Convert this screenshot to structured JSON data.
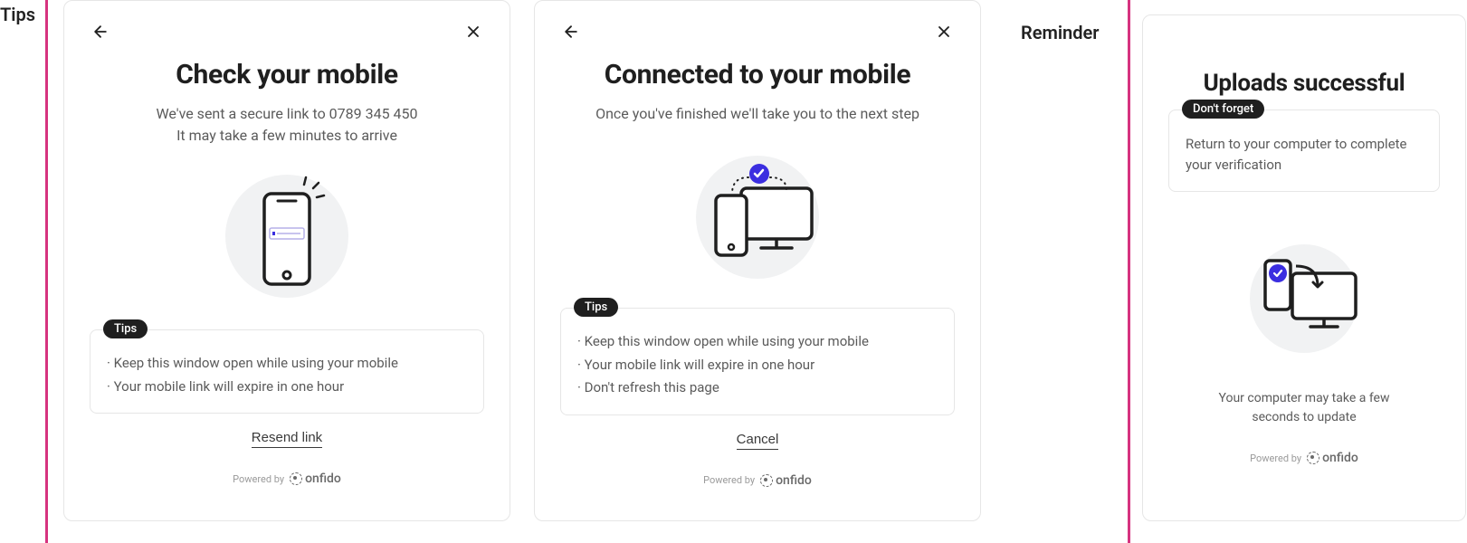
{
  "labels": {
    "tips": "Tips",
    "reminder": "Reminder"
  },
  "card1": {
    "title": "Check your mobile",
    "subtitle_line1": "We've sent a secure link to 0789 345 450",
    "subtitle_line2": "It may take a few minutes to arrive",
    "tips_label": "Tips",
    "tips": [
      "Keep this window open while using your mobile",
      "Your mobile link will expire in one hour"
    ],
    "action": "Resend link",
    "powered": "Powered by",
    "brand": "onfido"
  },
  "card2": {
    "title": "Connected to your mobile",
    "subtitle": "Once you've finished we'll take you to the next step",
    "tips_label": "Tips",
    "tips": [
      "Keep this window open while using your mobile",
      "Your mobile link will expire in one hour",
      "Don't refresh this page"
    ],
    "action": "Cancel",
    "powered": "Powered by",
    "brand": "onfido"
  },
  "card3": {
    "title": "Uploads successful",
    "reminder_label": "Don't forget",
    "reminder_text": "Return to your computer to complete your verification",
    "caption_line1": "Your computer may take a few",
    "caption_line2": "seconds to update",
    "powered": "Powered by",
    "brand": "onfido"
  }
}
